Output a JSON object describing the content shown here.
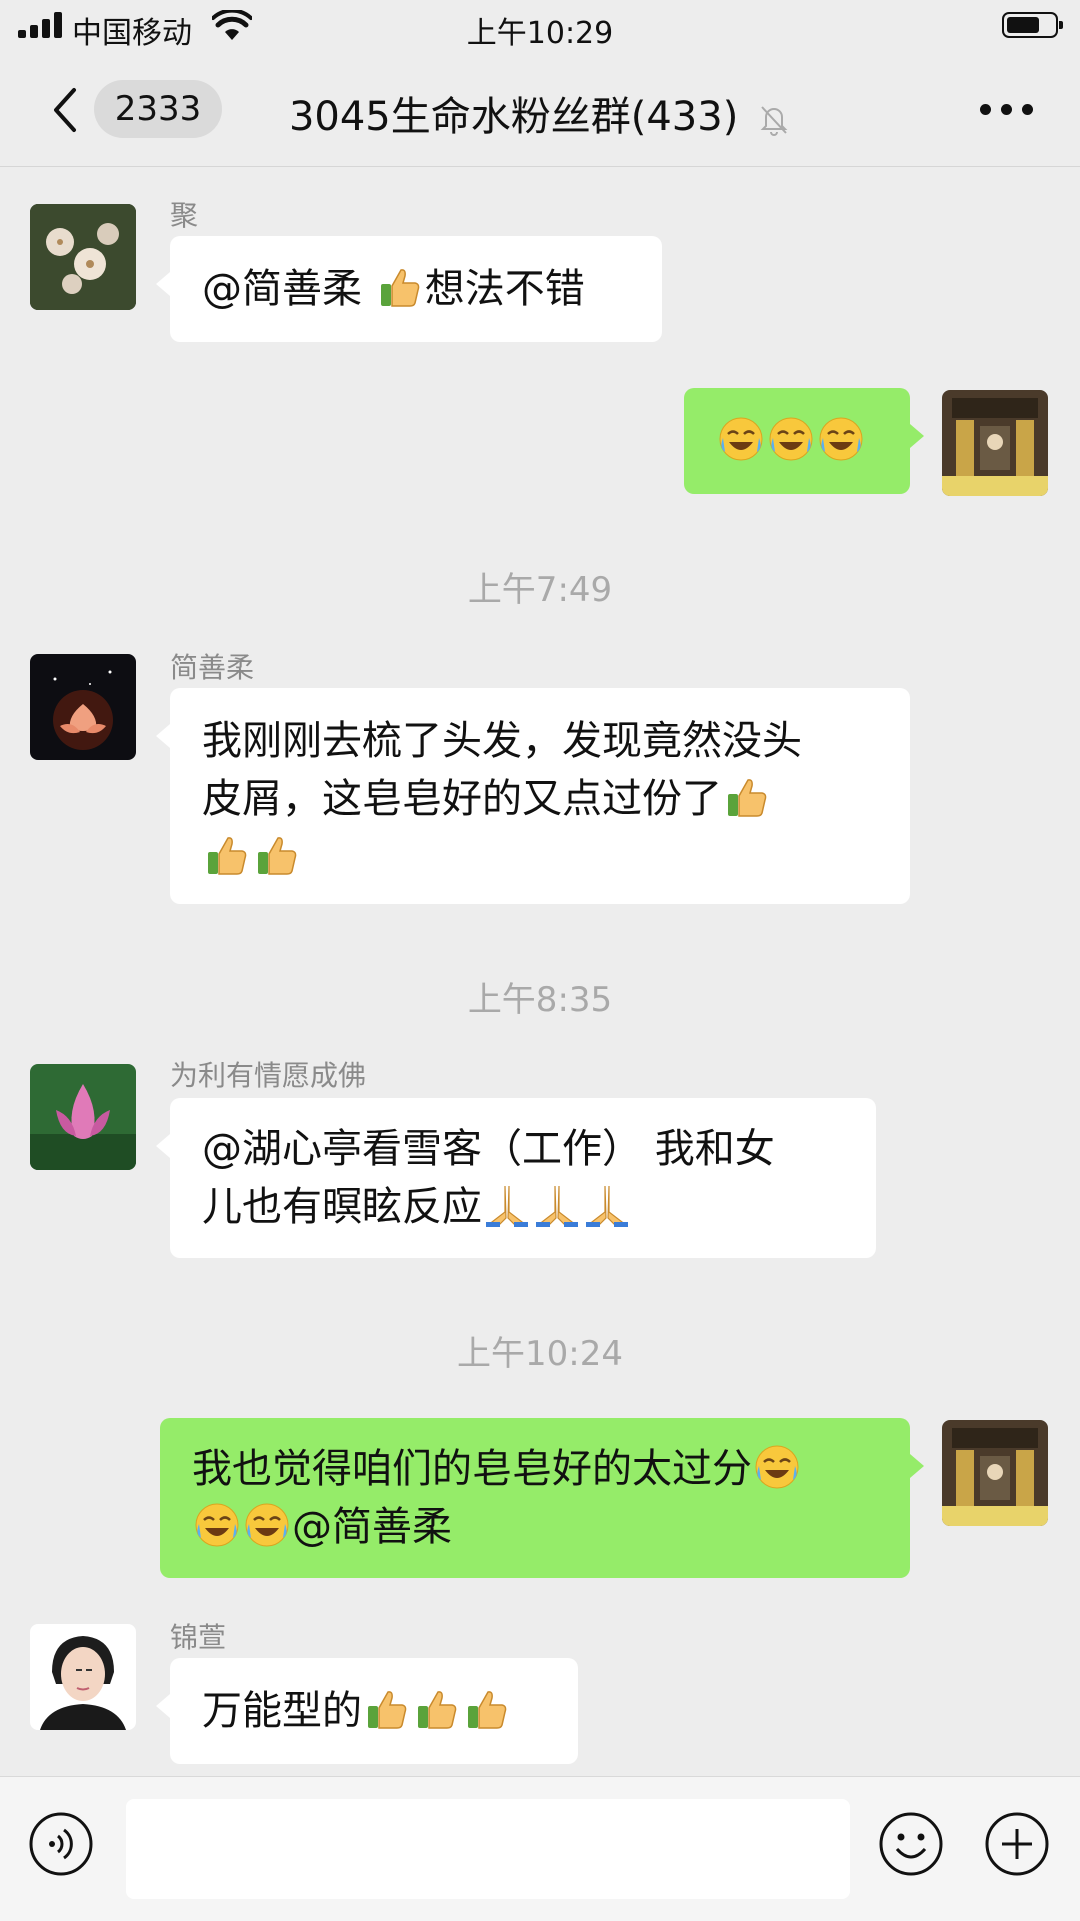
{
  "status_bar": {
    "carrier": "中国移动",
    "time": "上午10:29",
    "battery_percent": 70
  },
  "nav": {
    "unread_count": "2333",
    "title": "3045生命水粉丝群(433)",
    "muted": true
  },
  "messages": [
    {
      "type": "in",
      "sender": "聚",
      "avatar": "flower-avatar",
      "text": "@简善柔 ",
      "emojis_after": "thumbs-up",
      "text2": "想法不错"
    },
    {
      "type": "out",
      "emojis": [
        "laugh-cry",
        "laugh-cry",
        "laugh-cry"
      ],
      "avatar": "temple-avatar"
    },
    {
      "type": "time",
      "text": "上午7:49"
    },
    {
      "type": "in",
      "sender": "简善柔",
      "avatar": "lotus-dark-avatar",
      "line1": "我刚刚去梳了头发，发现竟然没头",
      "line2": "皮屑，这皂皂好的又点过份了",
      "emoji_line2": "thumbs-up",
      "emoji_line3": [
        "thumbs-up",
        "thumbs-up"
      ]
    },
    {
      "type": "time",
      "text": "上午8:35"
    },
    {
      "type": "in",
      "sender": "为利有情愿成佛",
      "avatar": "pink-lotus-avatar",
      "line1": "@湖心亭看雪客（工作） 我和女",
      "line2": "儿也有暝眩反应",
      "emojis": [
        "folded-hands",
        "folded-hands",
        "folded-hands"
      ]
    },
    {
      "type": "time",
      "text": "上午10:24"
    },
    {
      "type": "out",
      "avatar": "temple-avatar",
      "line1": "我也觉得咱们的皂皂好的太过分",
      "line2": "@简善柔"
    },
    {
      "type": "in",
      "sender": "锦萱",
      "avatar": "woman-portrait-avatar",
      "text": "万能型的",
      "emojis": [
        "thumbs-up",
        "thumbs-up",
        "thumbs-up"
      ]
    }
  ],
  "colors": {
    "background": "#ededed",
    "bubble_out": "#95ec69",
    "bubble_in": "#ffffff",
    "timestamp": "#a9a9a9"
  }
}
